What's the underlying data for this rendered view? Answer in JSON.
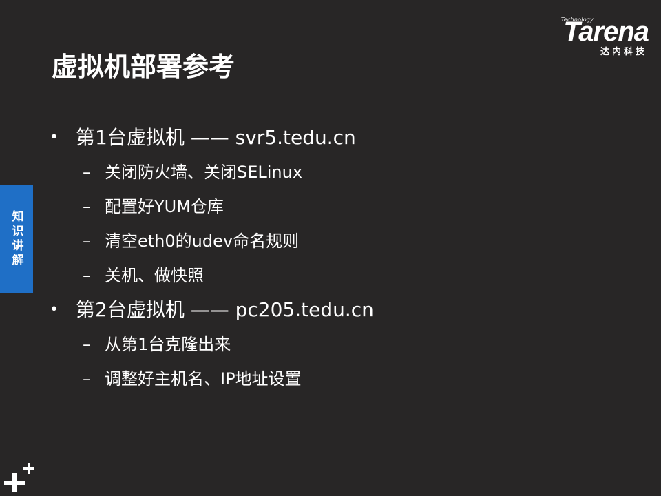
{
  "logo": {
    "tagline": "Technology",
    "brand": "Tarena",
    "brand_cn": "达内科技"
  },
  "slide": {
    "title": "虚拟机部署参考",
    "side_tab": "知识讲解",
    "items": [
      {
        "text": "第1台虚拟机 —— svr5.tedu.cn",
        "subitems": [
          "关闭防火墙、关闭SELinux",
          "配置好YUM仓库",
          "清空eth0的udev命名规则",
          "关机、做快照"
        ]
      },
      {
        "text": "第2台虚拟机 —— pc205.tedu.cn",
        "subitems": [
          "从第1台克隆出来",
          "调整好主机名、IP地址设置"
        ]
      }
    ]
  },
  "colors": {
    "background": "#282626",
    "accent_blue": "#1f6fc6",
    "text": "#ffffff"
  }
}
